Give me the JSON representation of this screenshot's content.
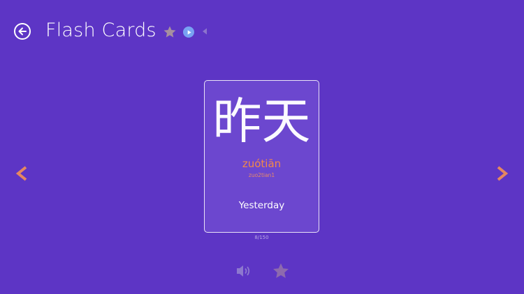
{
  "header": {
    "title": "Flash Cards",
    "icons": [
      "back-arrow-icon",
      "star-icon",
      "play-icon",
      "prev-triangle-icon"
    ]
  },
  "card": {
    "hanzi": "昨天",
    "pinyin": "zuótiān",
    "pinyin_numbered": "zuo2tian1",
    "meaning": "Yesterday"
  },
  "counter": "8/150",
  "colors": {
    "background": "#5d35c5",
    "card": "#6c47cf",
    "accent_orange": "#f2884a",
    "play_blue": "#78a2f2",
    "star_fill": "#a68f9f"
  }
}
